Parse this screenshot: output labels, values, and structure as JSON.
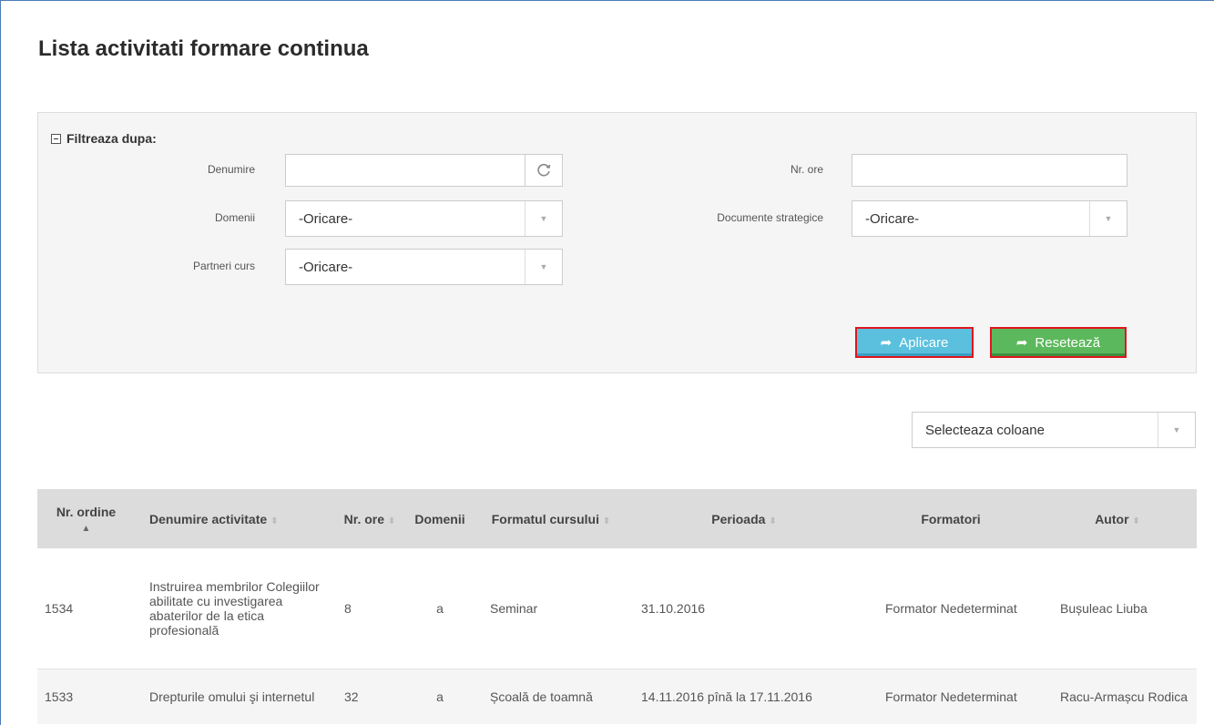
{
  "page": {
    "title": "Lista activitati formare continua"
  },
  "filter": {
    "title": "Filtreaza dupa:",
    "fields": {
      "denumire": {
        "label": "Denumire",
        "value": ""
      },
      "nr_ore": {
        "label": "Nr. ore",
        "value": ""
      },
      "domenii": {
        "label": "Domenii",
        "value": "-Oricare-"
      },
      "documente": {
        "label": "Documente strategice",
        "value": "-Oricare-"
      },
      "parteneri": {
        "label": "Partneri curs",
        "value": "-Oricare-"
      }
    },
    "apply_label": "Aplicare",
    "reset_label": "Resetează"
  },
  "column_select": {
    "value": "Selecteaza coloane"
  },
  "table": {
    "headers": {
      "nr_ordine": "Nr. ordine",
      "denumire": "Denumire activitate",
      "nr_ore": "Nr. ore",
      "domenii": "Domenii",
      "format": "Formatul cursului",
      "perioada": "Perioada",
      "formatori": "Formatori",
      "autor": "Autor"
    },
    "rows": [
      {
        "nr": "1534",
        "denumire": "Instruirea membrilor Colegiilor abilitate cu investigarea abaterilor de la etica profesională",
        "ore": "8",
        "domenii": "a",
        "format": "Seminar",
        "perioada": "31.10.2016",
        "formatori": "Formator Nedeterminat",
        "autor": "Bușuleac Liuba"
      },
      {
        "nr": "1533",
        "denumire": "Drepturile omului şi internetul",
        "ore": "32",
        "domenii": "a",
        "format": "Școală de toamnă",
        "perioada": "14.11.2016 pînă la 17.11.2016",
        "formatori": "Formator Nedeterminat",
        "autor": "Racu-Armașcu Rodica"
      }
    ]
  },
  "icons": {
    "refresh": "refresh-icon",
    "dropdown": "chevron-down-icon",
    "share_arrow": "share-arrow-icon"
  },
  "colors": {
    "apply_button": "#5bc0de",
    "reset_button": "#5cb85c",
    "highlight_border": "#e0141f",
    "link": "#8b1a1a"
  }
}
